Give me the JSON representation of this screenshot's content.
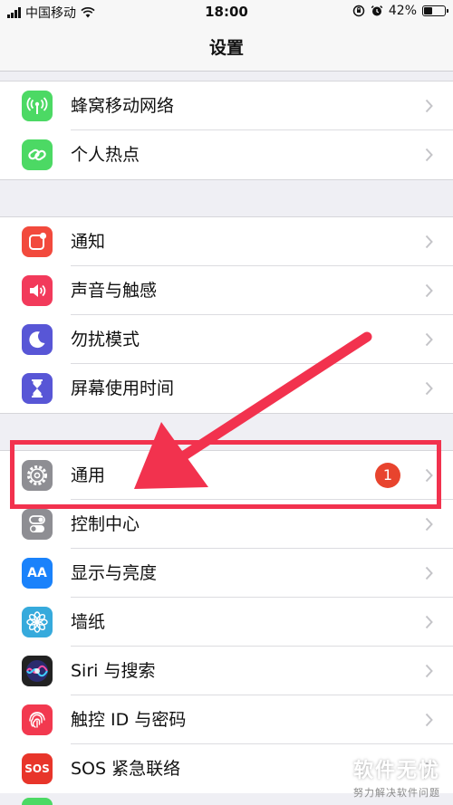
{
  "status": {
    "carrier": "中国移动",
    "time": "18:00",
    "battery": "42%",
    "battery_level": 0.42
  },
  "nav": {
    "title": "设置"
  },
  "groups": [
    {
      "items": [
        {
          "label": "蜂窝移动网络",
          "icon": "cellular-antenna-icon",
          "color": "#4cd964"
        },
        {
          "label": "个人热点",
          "icon": "hotspot-link-icon",
          "color": "#4cd964"
        }
      ]
    },
    {
      "items": [
        {
          "label": "通知",
          "icon": "notifications-icon",
          "color": "#f24a3d"
        },
        {
          "label": "声音与触感",
          "icon": "speaker-icon",
          "color": "#f23a5b"
        },
        {
          "label": "勿扰模式",
          "icon": "moon-icon",
          "color": "#5856d6"
        },
        {
          "label": "屏幕使用时间",
          "icon": "hourglass-icon",
          "color": "#5856d6"
        }
      ]
    },
    {
      "items": [
        {
          "label": "通用",
          "icon": "gear-icon",
          "color": "#8e8e93",
          "badge": "1"
        },
        {
          "label": "控制中心",
          "icon": "toggle-switches-icon",
          "color": "#8e8e93"
        },
        {
          "label": "显示与亮度",
          "icon": "text-size-icon",
          "color": "#1a82fb",
          "icon_text": "AA"
        },
        {
          "label": "墙纸",
          "icon": "flower-icon",
          "color": "#36aadc"
        },
        {
          "label": "Siri 与搜索",
          "icon": "siri-icon",
          "color": "#222222"
        },
        {
          "label": "触控 ID 与密码",
          "icon": "fingerprint-icon",
          "color": "#f2394f"
        },
        {
          "label": "SOS 紧急联络",
          "icon": "sos-icon",
          "color": "#e8352a",
          "icon_text": "SOS"
        }
      ]
    }
  ],
  "watermark": {
    "title": "软件无忧",
    "subtitle": "努力解决软件问题"
  },
  "annotation": {
    "highlight_color": "#f2324e"
  }
}
